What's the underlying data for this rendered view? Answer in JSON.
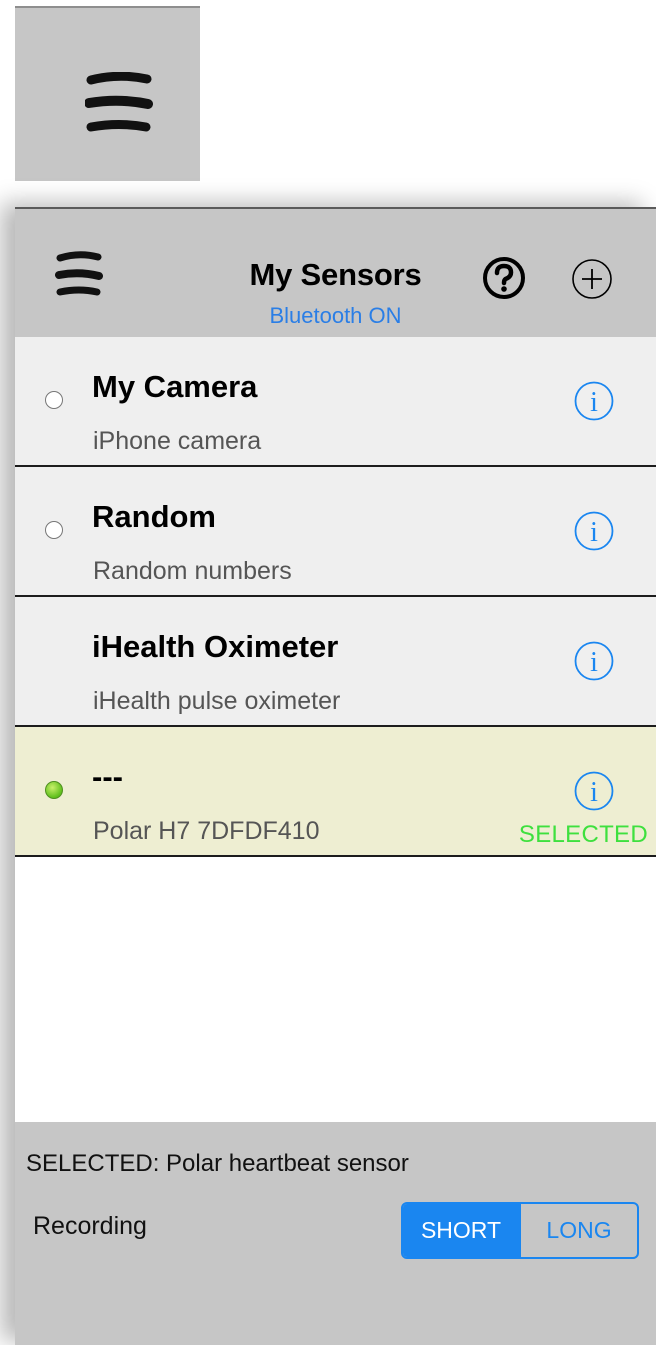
{
  "navbar": {
    "title": "My Sensors",
    "subtitle": "Bluetooth ON"
  },
  "sensors": [
    {
      "name": "My Camera",
      "description": "iPhone camera",
      "radio": "off",
      "state": ""
    },
    {
      "name": "Random",
      "description": "Random numbers",
      "radio": "off",
      "state": ""
    },
    {
      "name": "iHealth Oximeter",
      "description": "iHealth pulse oximeter",
      "radio": "none",
      "state": ""
    },
    {
      "name": "---",
      "description": "Polar H7 7DFDF410",
      "radio": "on",
      "state": "SELECTED"
    }
  ],
  "footer": {
    "selected_text": "SELECTED: Polar heartbeat sensor",
    "recording_label": "Recording",
    "recording_options": [
      "SHORT",
      "LONG"
    ],
    "recording_selected": "SHORT"
  },
  "icons": {
    "menu": "menu-icon",
    "help": "help-icon",
    "add": "add-icon",
    "info": "info-icon"
  },
  "colors": {
    "accent": "#1a86f0",
    "bluetooth_status": "#2a7ee6",
    "selected_state": "#3ee03e",
    "selected_row": "#eeeed2",
    "bar_gray": "#c6c6c6"
  }
}
